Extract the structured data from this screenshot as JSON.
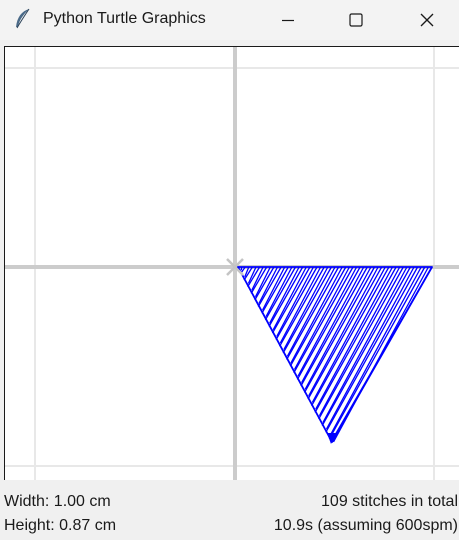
{
  "window": {
    "title": "Python Turtle Graphics",
    "icon": "feather-icon",
    "controls": [
      "minimize-icon",
      "maximize-icon",
      "close-icon"
    ]
  },
  "canvas": {
    "background": "#ffffff",
    "major_axis_color": "#cccccc",
    "minor_grid_color": "#e8e8e8",
    "stitch_color": "#0000ff",
    "shape": "downward-pointing triangle filled with diagonal hatch stitches"
  },
  "status": {
    "width_label": "Width: 1.00 cm",
    "height_label": "Height: 0.87 cm",
    "stitch_count": "109 stitches in total",
    "time_estimate": "10.9s (assuming 600spm)"
  }
}
